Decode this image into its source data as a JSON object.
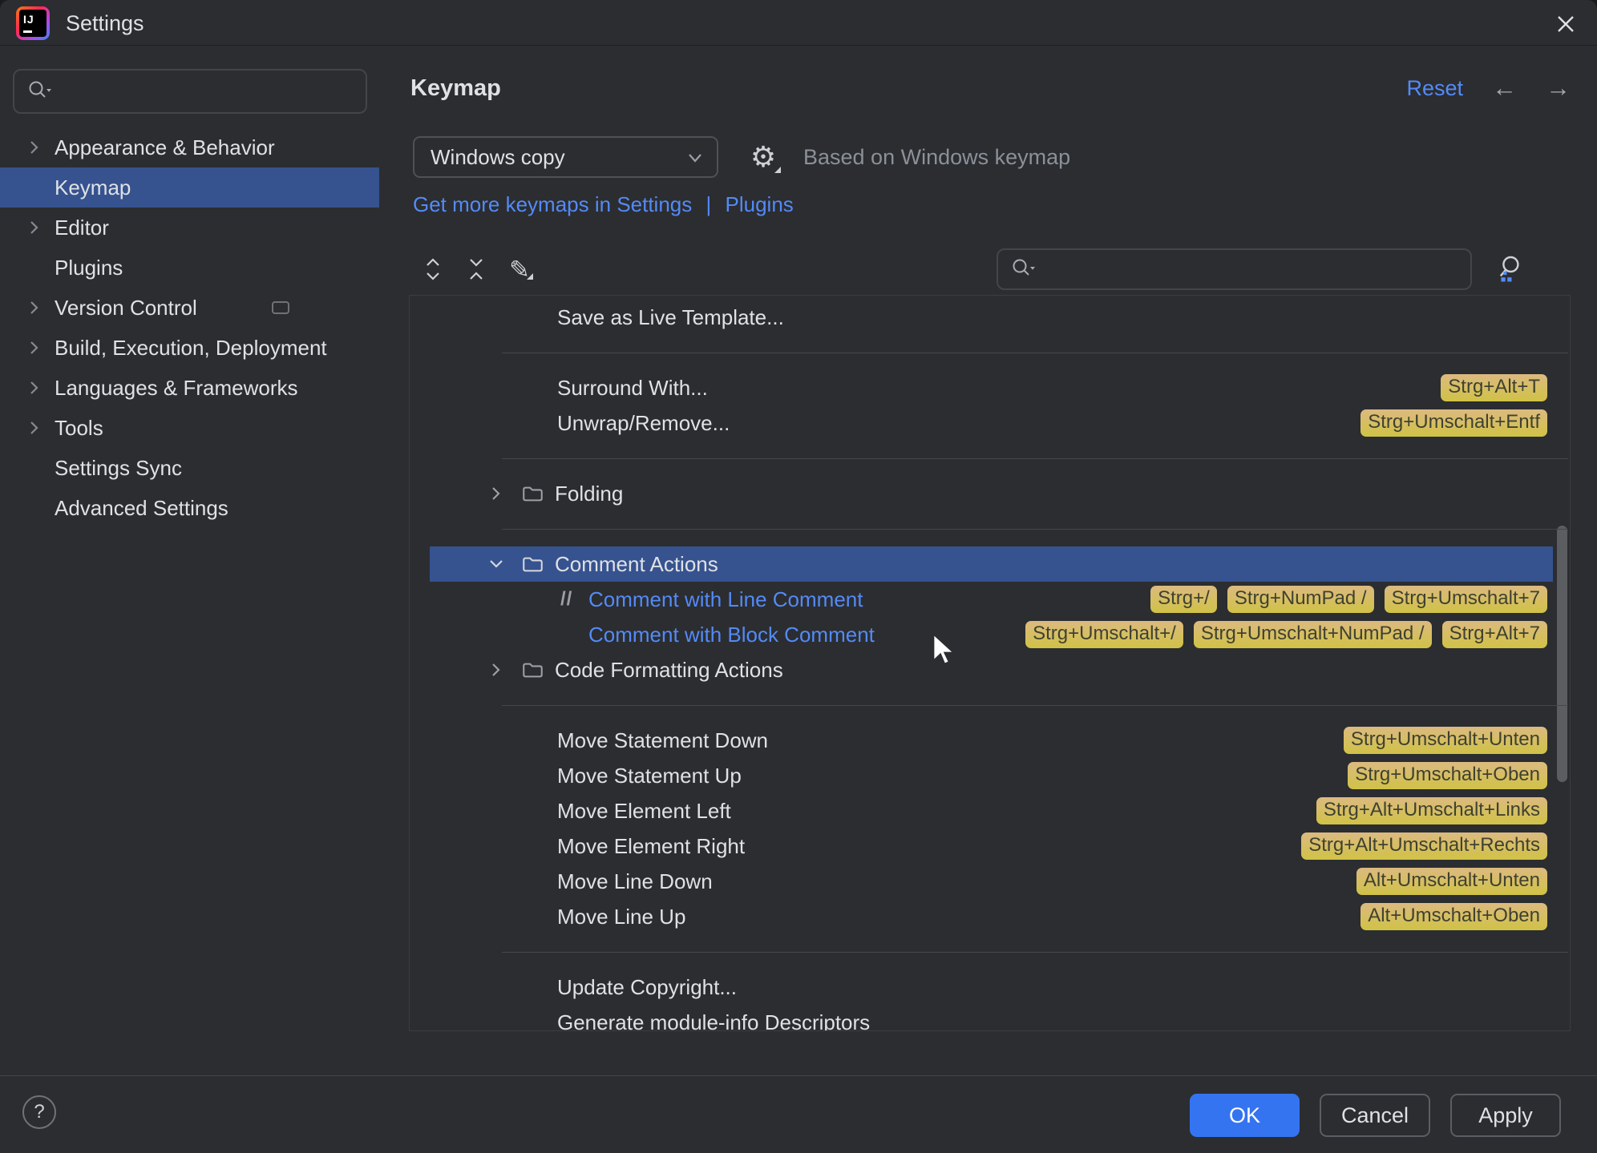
{
  "window": {
    "title": "Settings"
  },
  "sidebar": {
    "search_value": "",
    "items": [
      {
        "label": "Appearance & Behavior",
        "chevron": true,
        "selected": false
      },
      {
        "label": "Keymap",
        "chevron": false,
        "selected": true
      },
      {
        "label": "Editor",
        "chevron": true,
        "selected": false
      },
      {
        "label": "Plugins",
        "chevron": false,
        "selected": false
      },
      {
        "label": "Version Control",
        "chevron": true,
        "selected": false,
        "trailing_icon": true
      },
      {
        "label": "Build, Execution, Deployment",
        "chevron": true,
        "selected": false
      },
      {
        "label": "Languages & Frameworks",
        "chevron": true,
        "selected": false
      },
      {
        "label": "Tools",
        "chevron": true,
        "selected": false
      },
      {
        "label": "Settings Sync",
        "chevron": false,
        "selected": false
      },
      {
        "label": "Advanced Settings",
        "chevron": false,
        "selected": false
      }
    ]
  },
  "header": {
    "title": "Keymap",
    "reset_label": "Reset"
  },
  "keymap_bar": {
    "selected_keymap": "Windows copy",
    "based_on_note": "Based on Windows keymap",
    "get_more_label": "Get more keymaps in Settings",
    "link_divider": "|",
    "plugins_label": "Plugins"
  },
  "tree_search_value": "",
  "actions_tree": {
    "rows": [
      {
        "type": "action",
        "label": "Save as Live Template...",
        "shortcuts": []
      },
      {
        "type": "divider"
      },
      {
        "type": "action",
        "label": "Surround With...",
        "shortcuts": [
          "Strg+Alt+T"
        ]
      },
      {
        "type": "action",
        "label": "Unwrap/Remove...",
        "shortcuts": [
          "Strg+Umschalt+Entf"
        ]
      },
      {
        "type": "divider"
      },
      {
        "type": "group",
        "label": "Folding",
        "expanded": false,
        "selected": false
      },
      {
        "type": "divider"
      },
      {
        "type": "group",
        "label": "Comment Actions",
        "expanded": true,
        "selected": true
      },
      {
        "type": "child",
        "label": "Comment with Line Comment",
        "icon": "//",
        "shortcuts": [
          "Strg+/",
          "Strg+NumPad /",
          "Strg+Umschalt+7"
        ]
      },
      {
        "type": "child",
        "label": "Comment with Block Comment",
        "icon": "",
        "shortcuts": [
          "Strg+Umschalt+/",
          "Strg+Umschalt+NumPad /",
          "Strg+Alt+7"
        ]
      },
      {
        "type": "group",
        "label": "Code Formatting Actions",
        "expanded": false,
        "selected": false
      },
      {
        "type": "divider"
      },
      {
        "type": "action",
        "label": "Move Statement Down",
        "shortcuts": [
          "Strg+Umschalt+Unten"
        ]
      },
      {
        "type": "action",
        "label": "Move Statement Up",
        "shortcuts": [
          "Strg+Umschalt+Oben"
        ]
      },
      {
        "type": "action",
        "label": "Move Element Left",
        "shortcuts": [
          "Strg+Alt+Umschalt+Links"
        ]
      },
      {
        "type": "action",
        "label": "Move Element Right",
        "shortcuts": [
          "Strg+Alt+Umschalt+Rechts"
        ]
      },
      {
        "type": "action",
        "label": "Move Line Down",
        "shortcuts": [
          "Alt+Umschalt+Unten"
        ]
      },
      {
        "type": "action",
        "label": "Move Line Up",
        "shortcuts": [
          "Alt+Umschalt+Oben"
        ]
      },
      {
        "type": "divider"
      },
      {
        "type": "action",
        "label": "Update Copyright...",
        "shortcuts": []
      },
      {
        "type": "action",
        "label": "Generate module-info Descriptors",
        "shortcuts": []
      }
    ]
  },
  "footer": {
    "help": "?",
    "ok": "OK",
    "cancel": "Cancel",
    "apply": "Apply"
  },
  "colors": {
    "selection": "#36538F",
    "link": "#548AF7",
    "ok_button": "#3574F0",
    "badge_top": "#DCBA80",
    "badge_bottom": "#D0C246"
  }
}
